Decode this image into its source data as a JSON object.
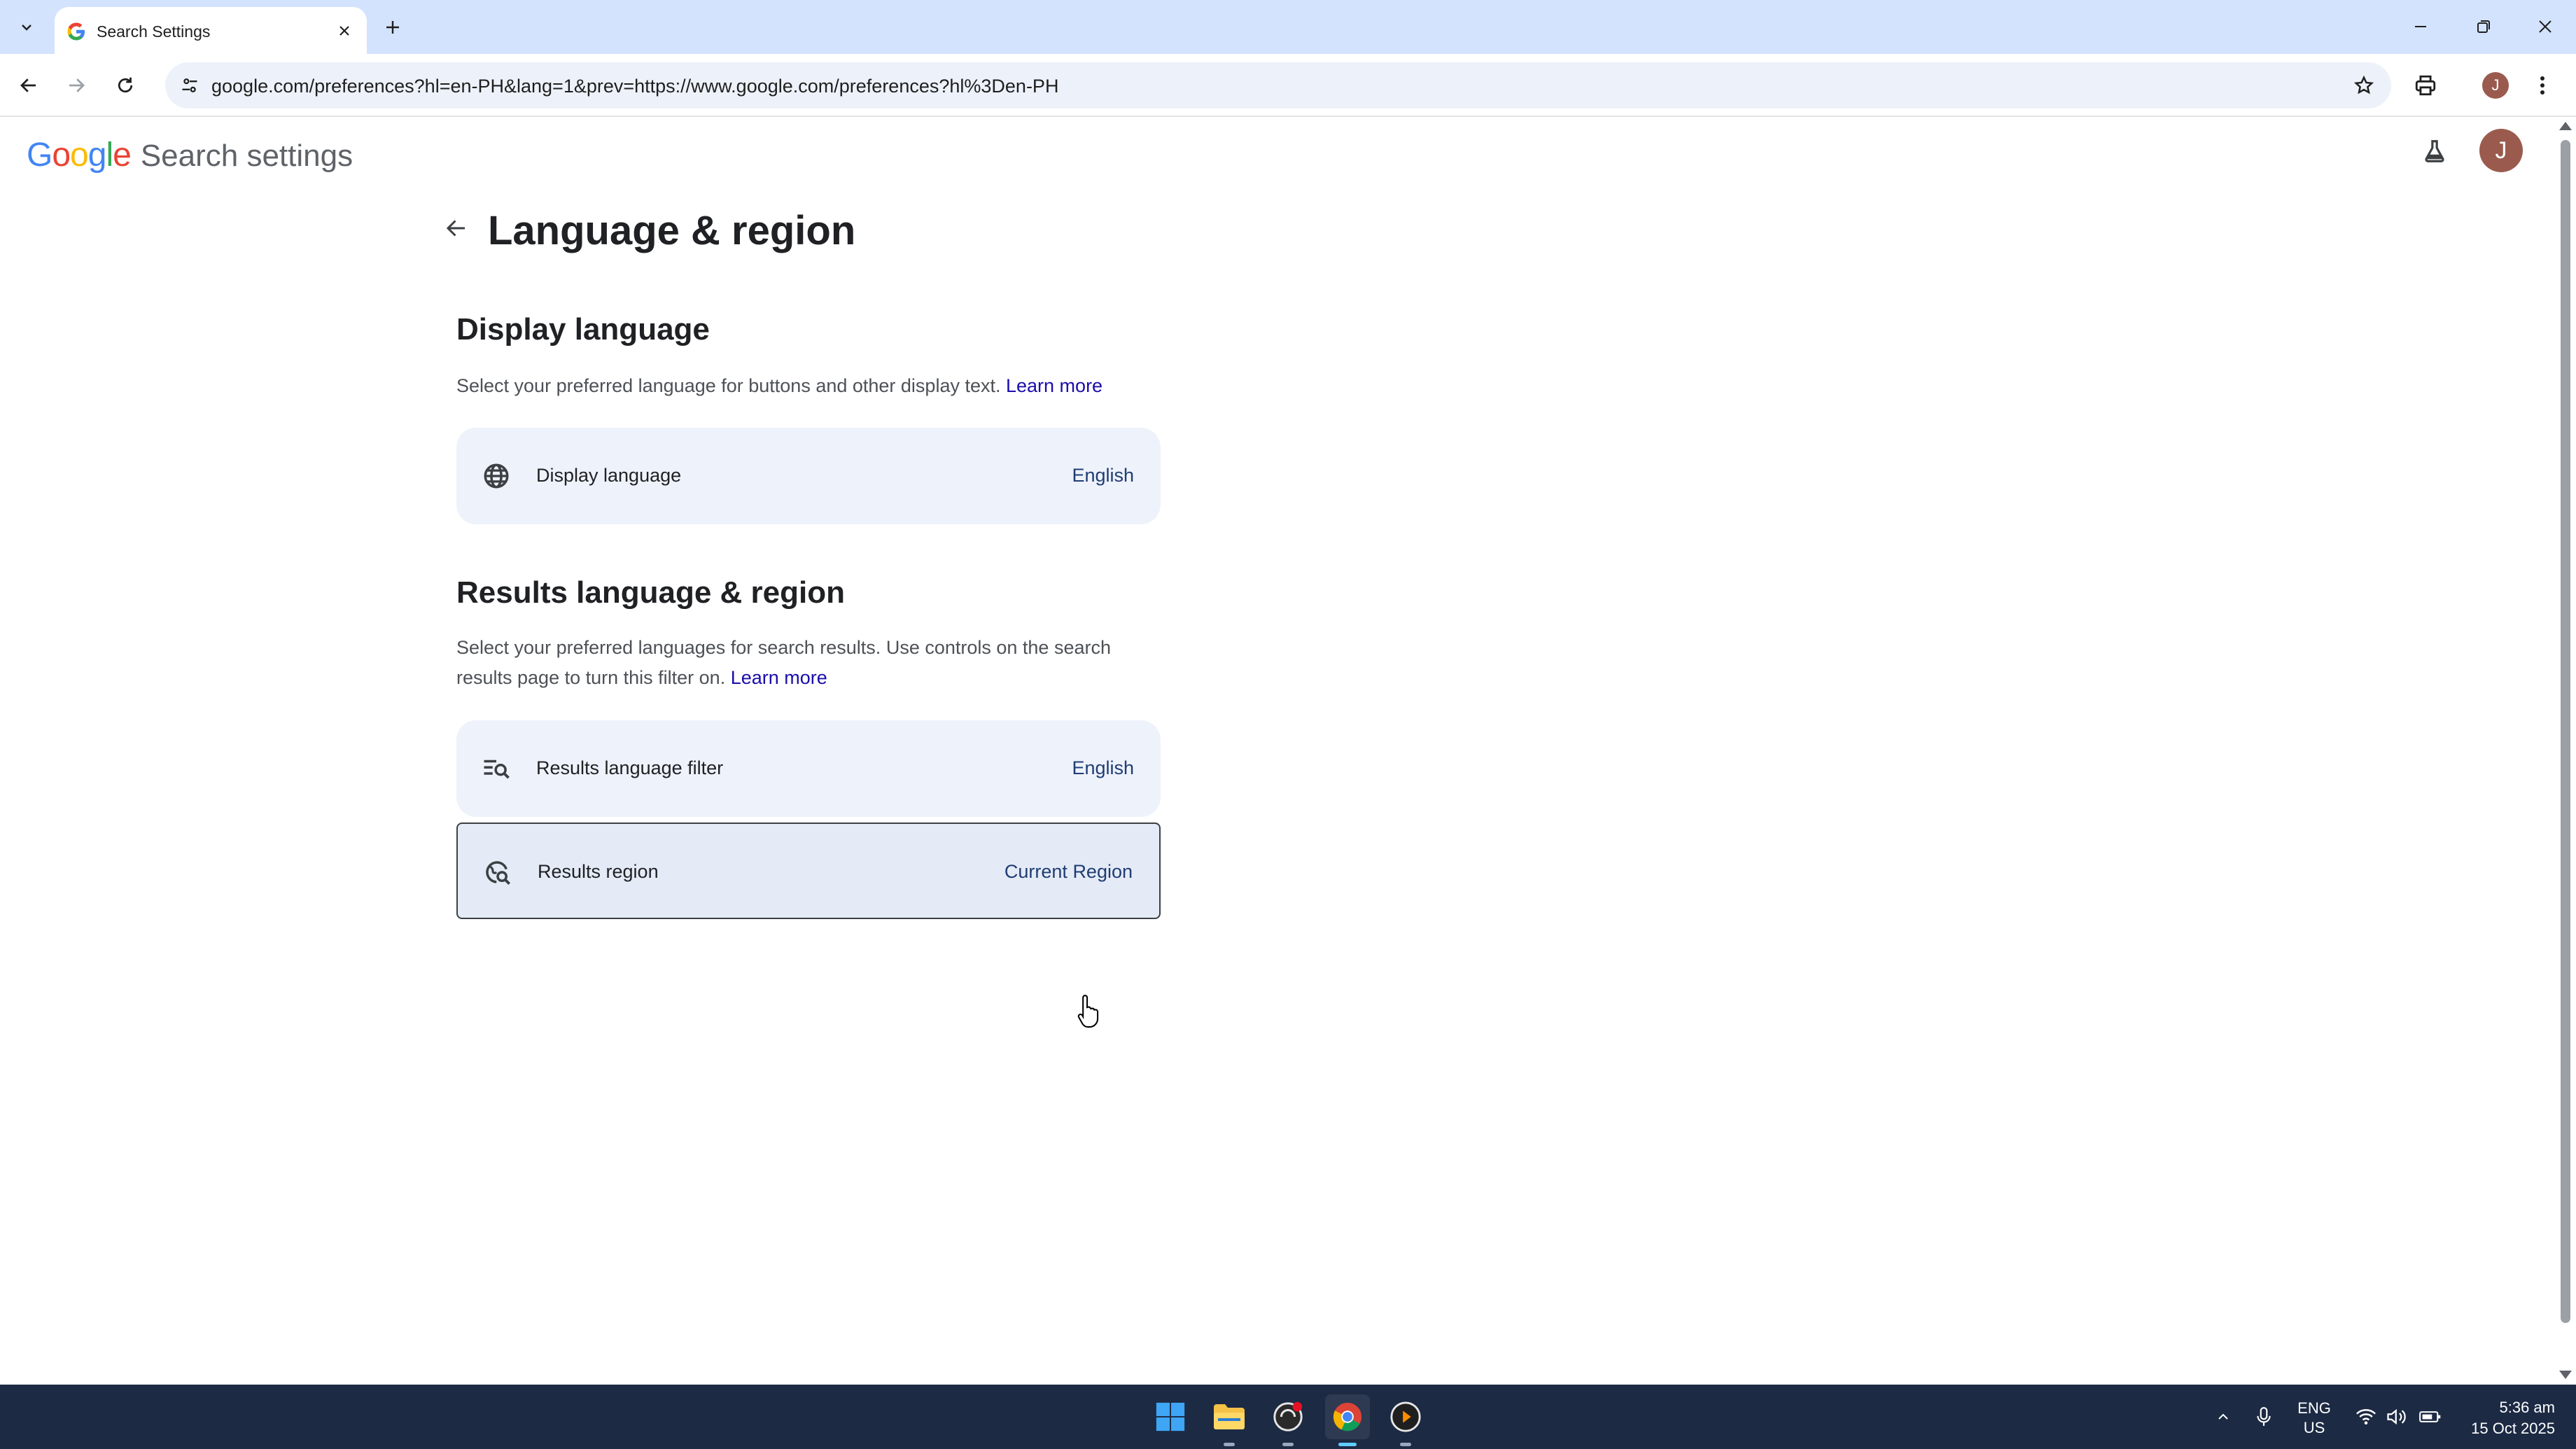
{
  "browser": {
    "tab_title": "Search Settings",
    "url": "google.com/preferences?hl=en-PH&lang=1&prev=https://www.google.com/preferences?hl%3Den-PH",
    "profile_initial": "J"
  },
  "header": {
    "logo_text": "Google",
    "title": "Search settings",
    "avatar_initial": "J"
  },
  "page": {
    "title": "Language & region"
  },
  "display_language": {
    "heading": "Display language",
    "description": "Select your preferred language for buttons and other display text.",
    "learn_more": "Learn more",
    "row_label": "Display language",
    "row_value": "English"
  },
  "results_language": {
    "heading": "Results language & region",
    "description": "Select your preferred languages for search results. Use controls on the search results page to turn this filter on.",
    "learn_more": "Learn more",
    "filter_label": "Results language filter",
    "filter_value": "English",
    "region_label": "Results region",
    "region_value": "Current Region"
  },
  "taskbar": {
    "lang_line1": "ENG",
    "lang_line2": "US",
    "time": "5:36 am",
    "date": "15 Oct 2025"
  },
  "colors": {
    "accent": "#1a0dab",
    "card_bg": "#eef2fb",
    "tabstrip": "#d3e3fd",
    "taskbar": "#1c2a44"
  }
}
